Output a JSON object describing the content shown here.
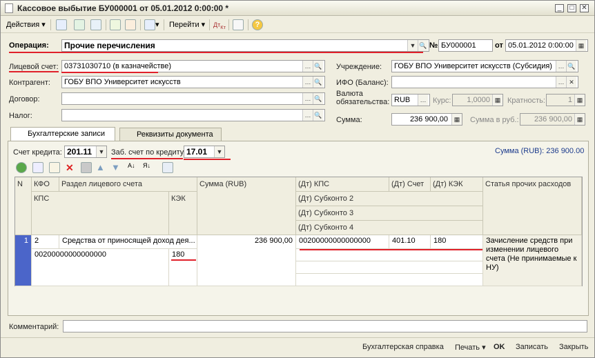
{
  "window": {
    "title": "Кассовое выбытие БУ000001 от 05.01.2012 0:00:00 *"
  },
  "toolbar": {
    "actions": "Действия",
    "goto": "Перейти"
  },
  "form": {
    "operation_label": "Операция:",
    "operation_value": "Прочие перечисления",
    "number_label": "№",
    "number_value": "БУ000001",
    "date_label": "от",
    "date_value": "05.01.2012 0:00:00",
    "account_label": "Лицевой счет:",
    "account_value": "03731030710 (в казначействе)",
    "institution_label": "Учреждение:",
    "institution_value": "ГОБУ ВПО Университет искусств (Субсидия)",
    "counterparty_label": "Контрагент:",
    "counterparty_value": "ГОБУ ВПО Университет искусств",
    "ifo_label": "ИФО (Баланс):",
    "ifo_value": "",
    "contract_label": "Договор:",
    "contract_value": "",
    "currency_label": "Валюта обязательства:",
    "currency_value": "RUB",
    "rate_label": "Курс:",
    "rate_value": "1,0000",
    "multiplicity_label": "Кратность:",
    "multiplicity_value": "1",
    "tax_label": "Налог:",
    "tax_value": "",
    "sum_label": "Сумма:",
    "sum_value": "236 900,00",
    "sum_rub_label": "Сумма в руб.:",
    "sum_rub_value": "236 900,00"
  },
  "tabs": [
    "Бухгалтерские записи",
    "Реквизиты документа"
  ],
  "entries": {
    "credit_label": "Счет кредита:",
    "credit_value": "201.11",
    "offbalance_label": "Заб. счет по кредиту:",
    "offbalance_value": "17.01",
    "total": "Сумма (RUB): 236 900.00"
  },
  "grid": {
    "headers": {
      "n": "N",
      "kfo": "КФО",
      "section": "Раздел лицевого счета",
      "kps": "КПС",
      "kek": "КЭК",
      "sum": "Сумма (RUB)",
      "dt_kps": "(Дт) КПС",
      "dt_acc": "(Дт) Счет",
      "dt_kek": "(Дт) КЭК",
      "article": "Статья прочих расходов",
      "sub2": "(Дт) Субконто 2",
      "sub3": "(Дт) Субконто 3",
      "sub4": "(Дт) Субконто 4"
    },
    "row": {
      "n": "1",
      "kfo": "2",
      "section": "Средства от приносящей доход дея...",
      "kps": "00200000000000000",
      "kek": "180",
      "sum": "236 900,00",
      "dt_kps": "00200000000000000",
      "dt_acc": "401.10",
      "dt_kek": "180",
      "article": "Зачисление средств при изменении лицевого счета (Не принимаемые к НУ)"
    }
  },
  "comment_label": "Комментарий:",
  "footer": {
    "report": "Бухгалтерская справка",
    "print": "Печать",
    "ok": "OK",
    "save": "Записать",
    "close": "Закрыть"
  }
}
